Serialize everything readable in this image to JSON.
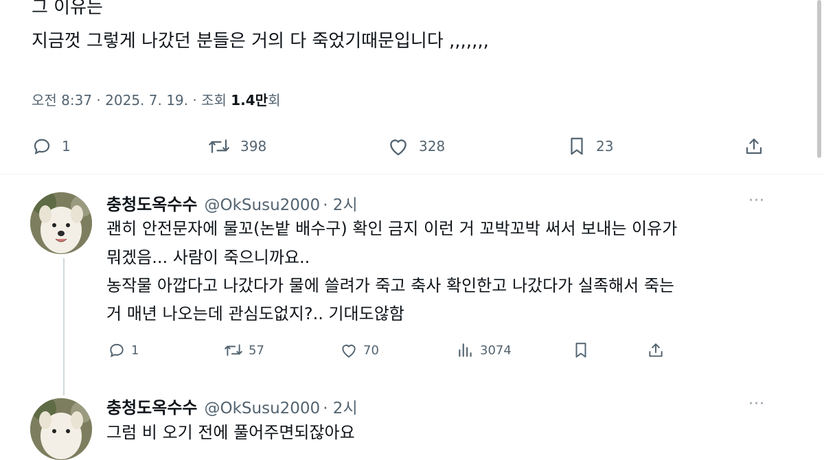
{
  "tweet": {
    "lines": [
      "그 이유는",
      "지금껏 그렇게 나갔던 분들은 거의 다 죽었기때문입니다 ,,,,,,,"
    ],
    "meta_prefix": "오전 8:37 · 2025. 7. 19. · 조회 ",
    "views": "1.4만",
    "views_suffix": "회",
    "stats": {
      "replies": "1",
      "retweets": "398",
      "likes": "328",
      "bookmarks": "23"
    }
  },
  "replies": [
    {
      "name": "충청도옥수수",
      "handle": "@OkSusu2000",
      "time": "· 2시",
      "more": "···",
      "lines": [
        "괜히 안전문자에 물꼬(논밭 배수구) 확인 금지 이런 거 꼬박꼬박 써서 보내는 이유가",
        "뭐겠음... 사람이 죽으니까요..",
        "농작물 아깝다고 나갔다가 물에 쓸려가 죽고 축사 확인한고 나갔다가 실족해서 죽는",
        "거 매년 나오는데 관심도없지?.. 기대도않함"
      ],
      "stats": {
        "replies": "1",
        "retweets": "57",
        "likes": "70",
        "views": "3074"
      }
    },
    {
      "name": "충청도옥수수",
      "handle": "@OkSusu2000",
      "time": "· 2시",
      "more": "···",
      "lines": [
        "그럼 비 오기 전에 풀어주면되잖아요"
      ]
    }
  ],
  "colors": {
    "text": "#0f1419",
    "secondary": "#536471",
    "divider": "#eff3f4"
  }
}
